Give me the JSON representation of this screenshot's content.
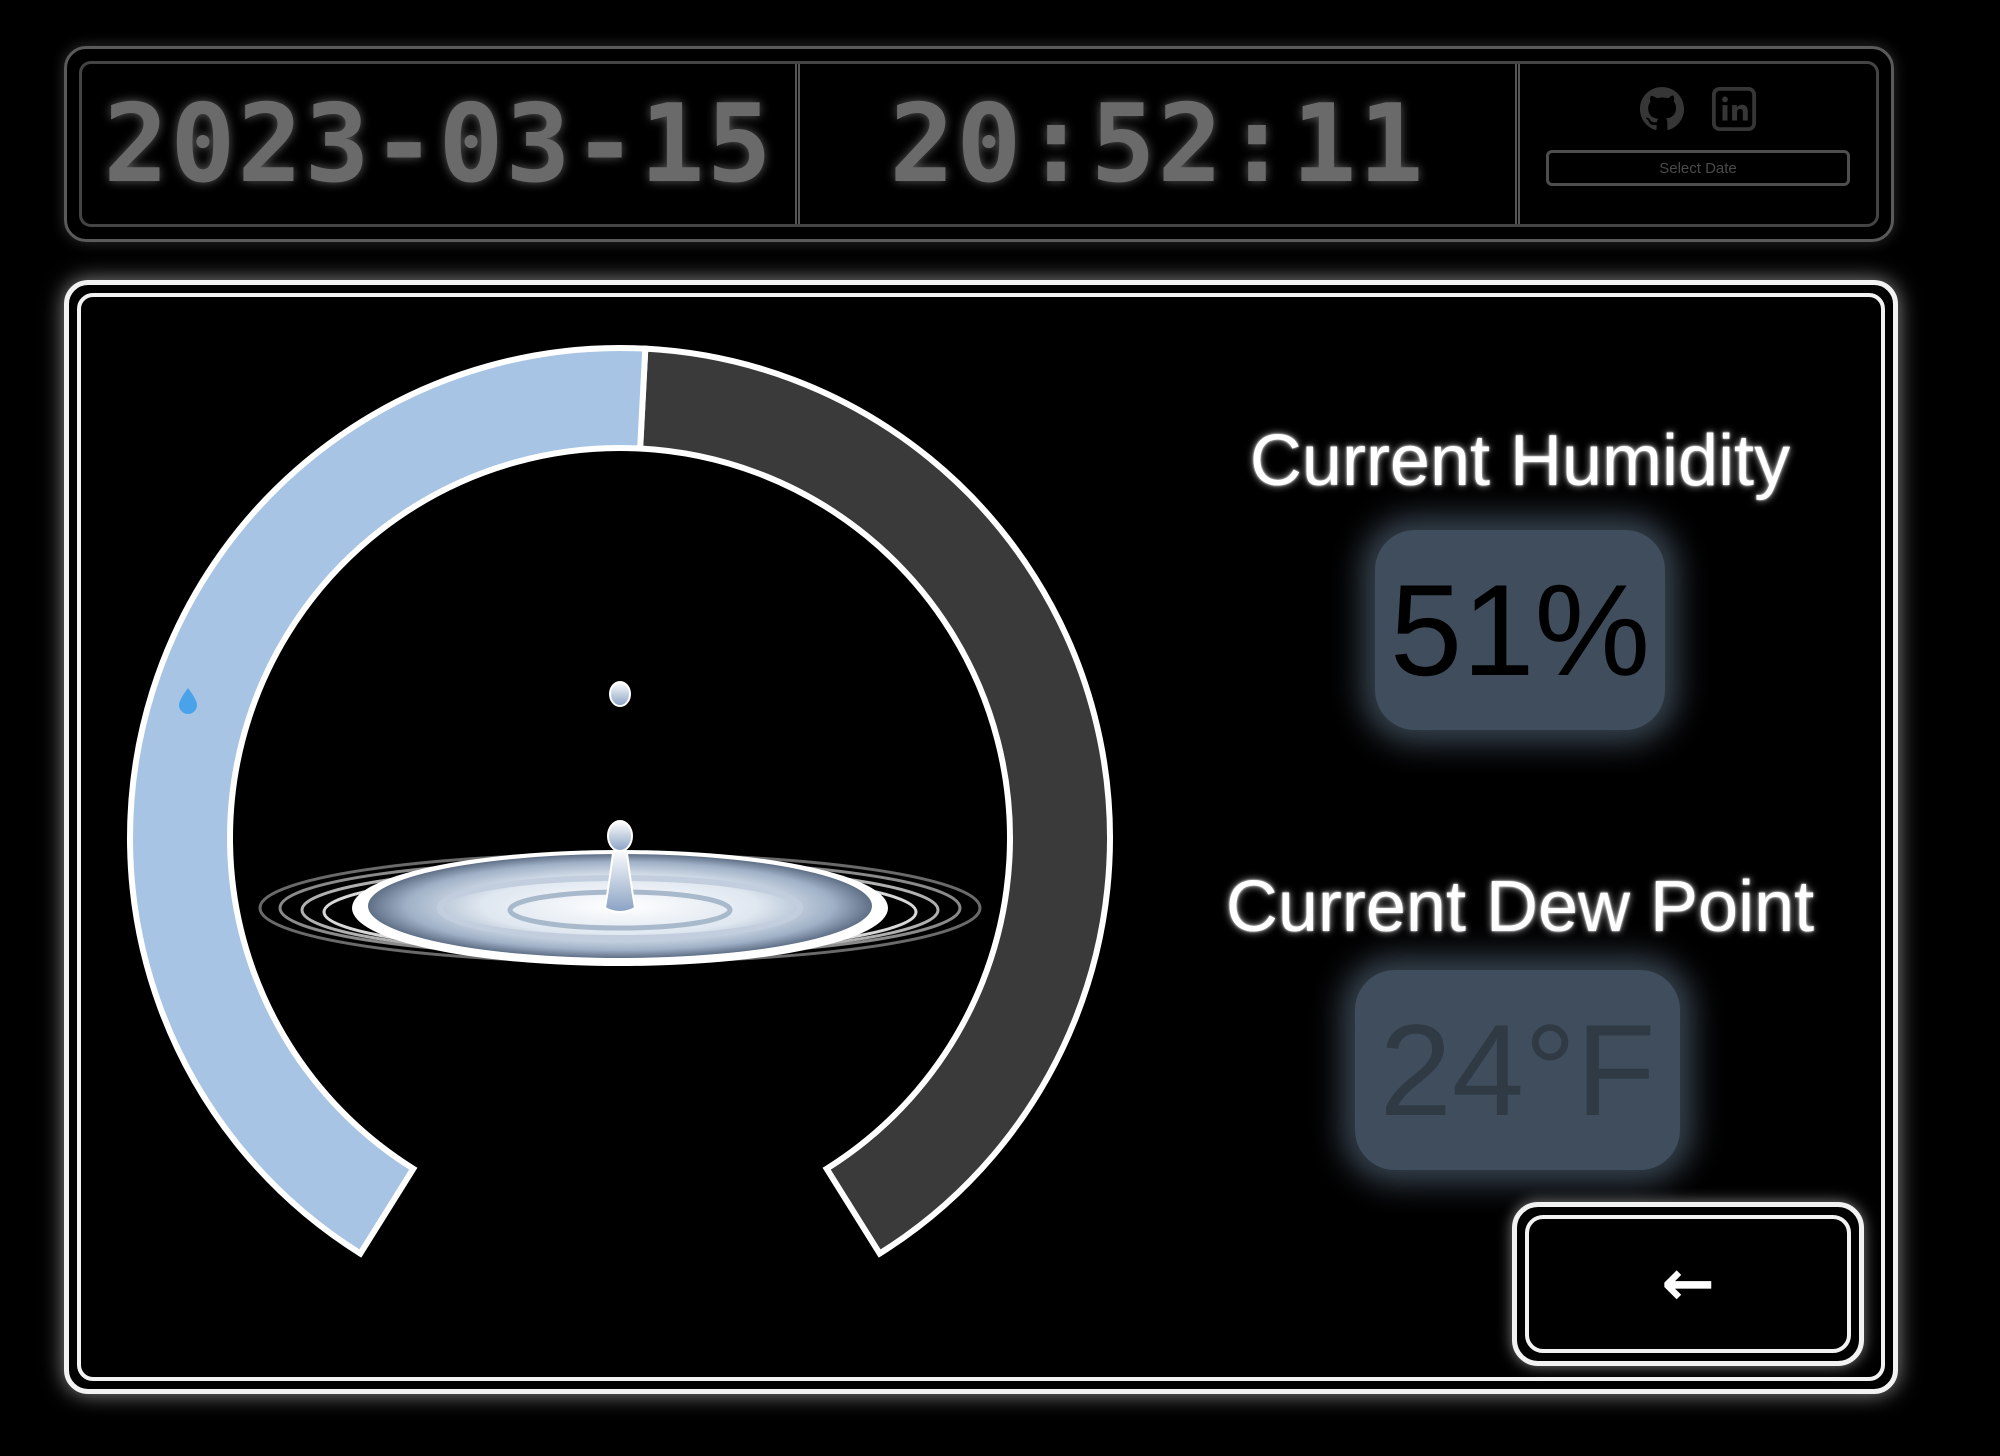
{
  "header": {
    "date": "2023-03-15",
    "time": "20:52:11",
    "icons": [
      "github-icon",
      "linkedin-icon"
    ],
    "select_date_label": "Select Date"
  },
  "humidity": {
    "label": "Current Humidity",
    "value": "51%",
    "gauge_fraction": 0.51
  },
  "dew_point": {
    "label": "Current Dew Point",
    "value": "24°F"
  },
  "back_button": {
    "label": "←"
  },
  "colors": {
    "gauge_fill": "#a8c4e4",
    "gauge_track": "#3a3a3a",
    "value_box": "#3f4d5c",
    "frame": "#f2f2f2"
  }
}
